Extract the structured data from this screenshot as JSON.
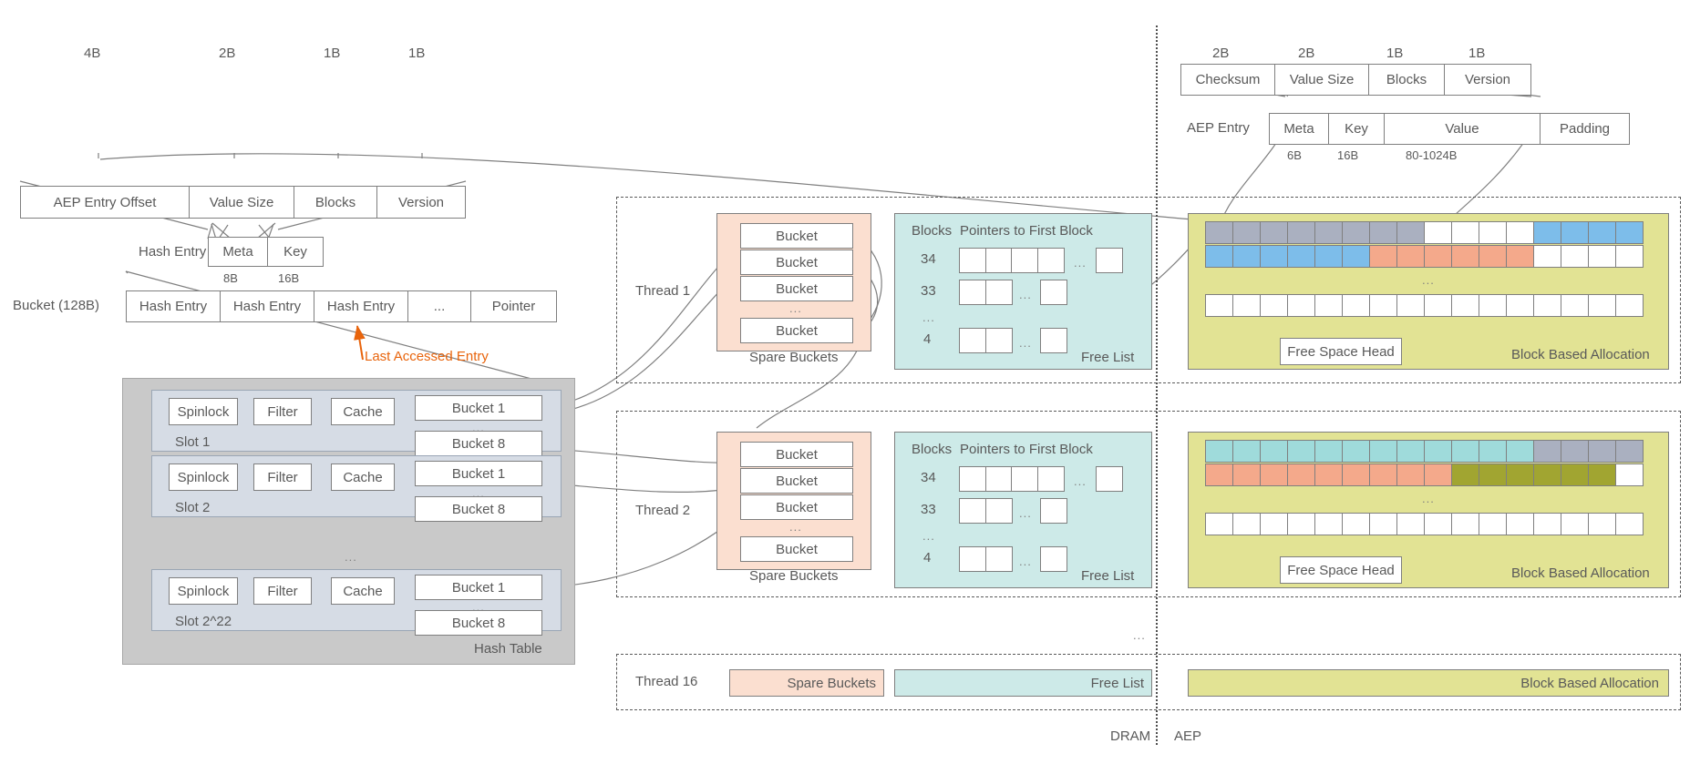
{
  "hash_entry_fields": {
    "sizes": [
      "4B",
      "2B",
      "1B",
      "1B"
    ],
    "cells": [
      "AEP Entry Offset",
      "Value Size",
      "Blocks",
      "Version"
    ]
  },
  "aep_entry_fields": {
    "sizes": [
      "2B",
      "2B",
      "1B",
      "1B"
    ],
    "cells": [
      "Checksum",
      "Value Size",
      "Blocks",
      "Version"
    ]
  },
  "aep_entry_row": {
    "label": "AEP Entry",
    "cells": [
      "Meta",
      "Key",
      "Value",
      "Padding"
    ],
    "sizes": [
      "6B",
      "16B",
      "80-1024B"
    ]
  },
  "hash_entry_row": {
    "label": "Hash Entry",
    "cells": [
      "Meta",
      "Key"
    ],
    "sizes": [
      "8B",
      "16B"
    ]
  },
  "bucket_row": {
    "label": "Bucket (128B)",
    "cells": [
      "Hash Entry",
      "Hash Entry",
      "Hash Entry",
      "...",
      "Pointer"
    ]
  },
  "annotations": {
    "last_accessed_entry": "Last Accessed Entry"
  },
  "hash_table": {
    "title": "Hash Table",
    "ellipsis": "...",
    "slots": [
      {
        "name": "Slot 1",
        "controls": [
          "Spinlock",
          "Filter",
          "Cache"
        ],
        "buckets": [
          "Bucket 1",
          "Bucket 8"
        ],
        "bucket_ellipsis": "..."
      },
      {
        "name": "Slot 2",
        "controls": [
          "Spinlock",
          "Filter",
          "Cache"
        ],
        "buckets": [
          "Bucket 1",
          "Bucket 8"
        ],
        "bucket_ellipsis": "..."
      },
      {
        "name": "Slot 2^22",
        "controls": [
          "Spinlock",
          "Filter",
          "Cache"
        ],
        "buckets": [
          "Bucket 1",
          "Bucket 8"
        ],
        "bucket_ellipsis": "..."
      }
    ]
  },
  "threads": [
    {
      "name": "Thread 1",
      "spare": {
        "title": "Spare Buckets",
        "items": [
          "Bucket",
          "Bucket",
          "Bucket",
          "Bucket"
        ],
        "ellipsis": "..."
      },
      "free_list": {
        "title": "Free List",
        "col_blocks": "Blocks",
        "col_pointers": "Pointers to First Block",
        "rows": [
          {
            "blocks": "34",
            "boxes": 4,
            "ellipsis": "...",
            "tail_boxes": 1
          },
          {
            "blocks": "33",
            "boxes": 2,
            "ellipsis": "...",
            "tail_boxes": 1
          },
          {
            "blocks": "...",
            "boxes": 0,
            "ellipsis": "",
            "tail_boxes": 0
          },
          {
            "blocks": "4",
            "boxes": 2,
            "ellipsis": "...",
            "tail_boxes": 1
          }
        ]
      },
      "allocation": {
        "title": "Block Based Allocation",
        "free_space_head": "Free Space Head",
        "ellipsis": "...",
        "row1": [
          "#aab0c0",
          "#aab0c0",
          "#aab0c0",
          "#aab0c0",
          "#aab0c0",
          "#aab0c0",
          "#aab0c0",
          "#aab0c0",
          "#ffffff",
          "#ffffff",
          "#ffffff",
          "#ffffff",
          "#7dbdea",
          "#7dbdea",
          "#7dbdea",
          "#7dbdea"
        ],
        "row2": [
          "#7dbdea",
          "#7dbdea",
          "#7dbdea",
          "#7dbdea",
          "#7dbdea",
          "#7dbdea",
          "#f4a98b",
          "#f4a98b",
          "#f4a98b",
          "#f4a98b",
          "#f4a98b",
          "#f4a98b",
          "#ffffff",
          "#ffffff",
          "#ffffff",
          "#ffffff"
        ],
        "row3_count": 16
      }
    },
    {
      "name": "Thread 2",
      "spare": {
        "title": "Spare Buckets",
        "items": [
          "Bucket",
          "Bucket",
          "Bucket",
          "Bucket"
        ],
        "ellipsis": "..."
      },
      "free_list": {
        "title": "Free List",
        "col_blocks": "Blocks",
        "col_pointers": "Pointers to First Block",
        "rows": [
          {
            "blocks": "34",
            "boxes": 4,
            "ellipsis": "...",
            "tail_boxes": 1
          },
          {
            "blocks": "33",
            "boxes": 2,
            "ellipsis": "...",
            "tail_boxes": 1
          },
          {
            "blocks": "...",
            "boxes": 0,
            "ellipsis": "",
            "tail_boxes": 0
          },
          {
            "blocks": "4",
            "boxes": 2,
            "ellipsis": "...",
            "tail_boxes": 1
          }
        ]
      },
      "allocation": {
        "title": "Block Based Allocation",
        "free_space_head": "Free Space Head",
        "ellipsis": "...",
        "row1": [
          "#9fdbdb",
          "#9fdbdb",
          "#9fdbdb",
          "#9fdbdb",
          "#9fdbdb",
          "#9fdbdb",
          "#9fdbdb",
          "#9fdbdb",
          "#9fdbdb",
          "#9fdbdb",
          "#9fdbdb",
          "#9fdbdb",
          "#aab0c0",
          "#aab0c0",
          "#aab0c0",
          "#aab0c0"
        ],
        "row2": [
          "#f4a98b",
          "#f4a98b",
          "#f4a98b",
          "#f4a98b",
          "#f4a98b",
          "#f4a98b",
          "#f4a98b",
          "#f4a98b",
          "#f4a98b",
          "#a1a531",
          "#a1a531",
          "#a1a531",
          "#a1a531",
          "#a1a531",
          "#a1a531",
          "#ffffff"
        ],
        "row3_count": 16
      }
    }
  ],
  "thread_ellipsis": "...",
  "thread16": {
    "name": "Thread 16",
    "spare_title": "Spare Buckets",
    "free_list_title": "Free List",
    "allocation_title": "Block Based Allocation"
  },
  "memory_labels": {
    "dram": "DRAM",
    "aep": "AEP"
  },
  "colors": {
    "accent_orange": "#e8640c",
    "stroke": "#7f7f7f",
    "text": "#595959",
    "spare_bg": "#fbdfd0",
    "free_bg": "#cdeae8",
    "bba_bg": "#e2e394",
    "slot_bg": "#d6dce5",
    "table_bg": "#c9c9c9"
  }
}
